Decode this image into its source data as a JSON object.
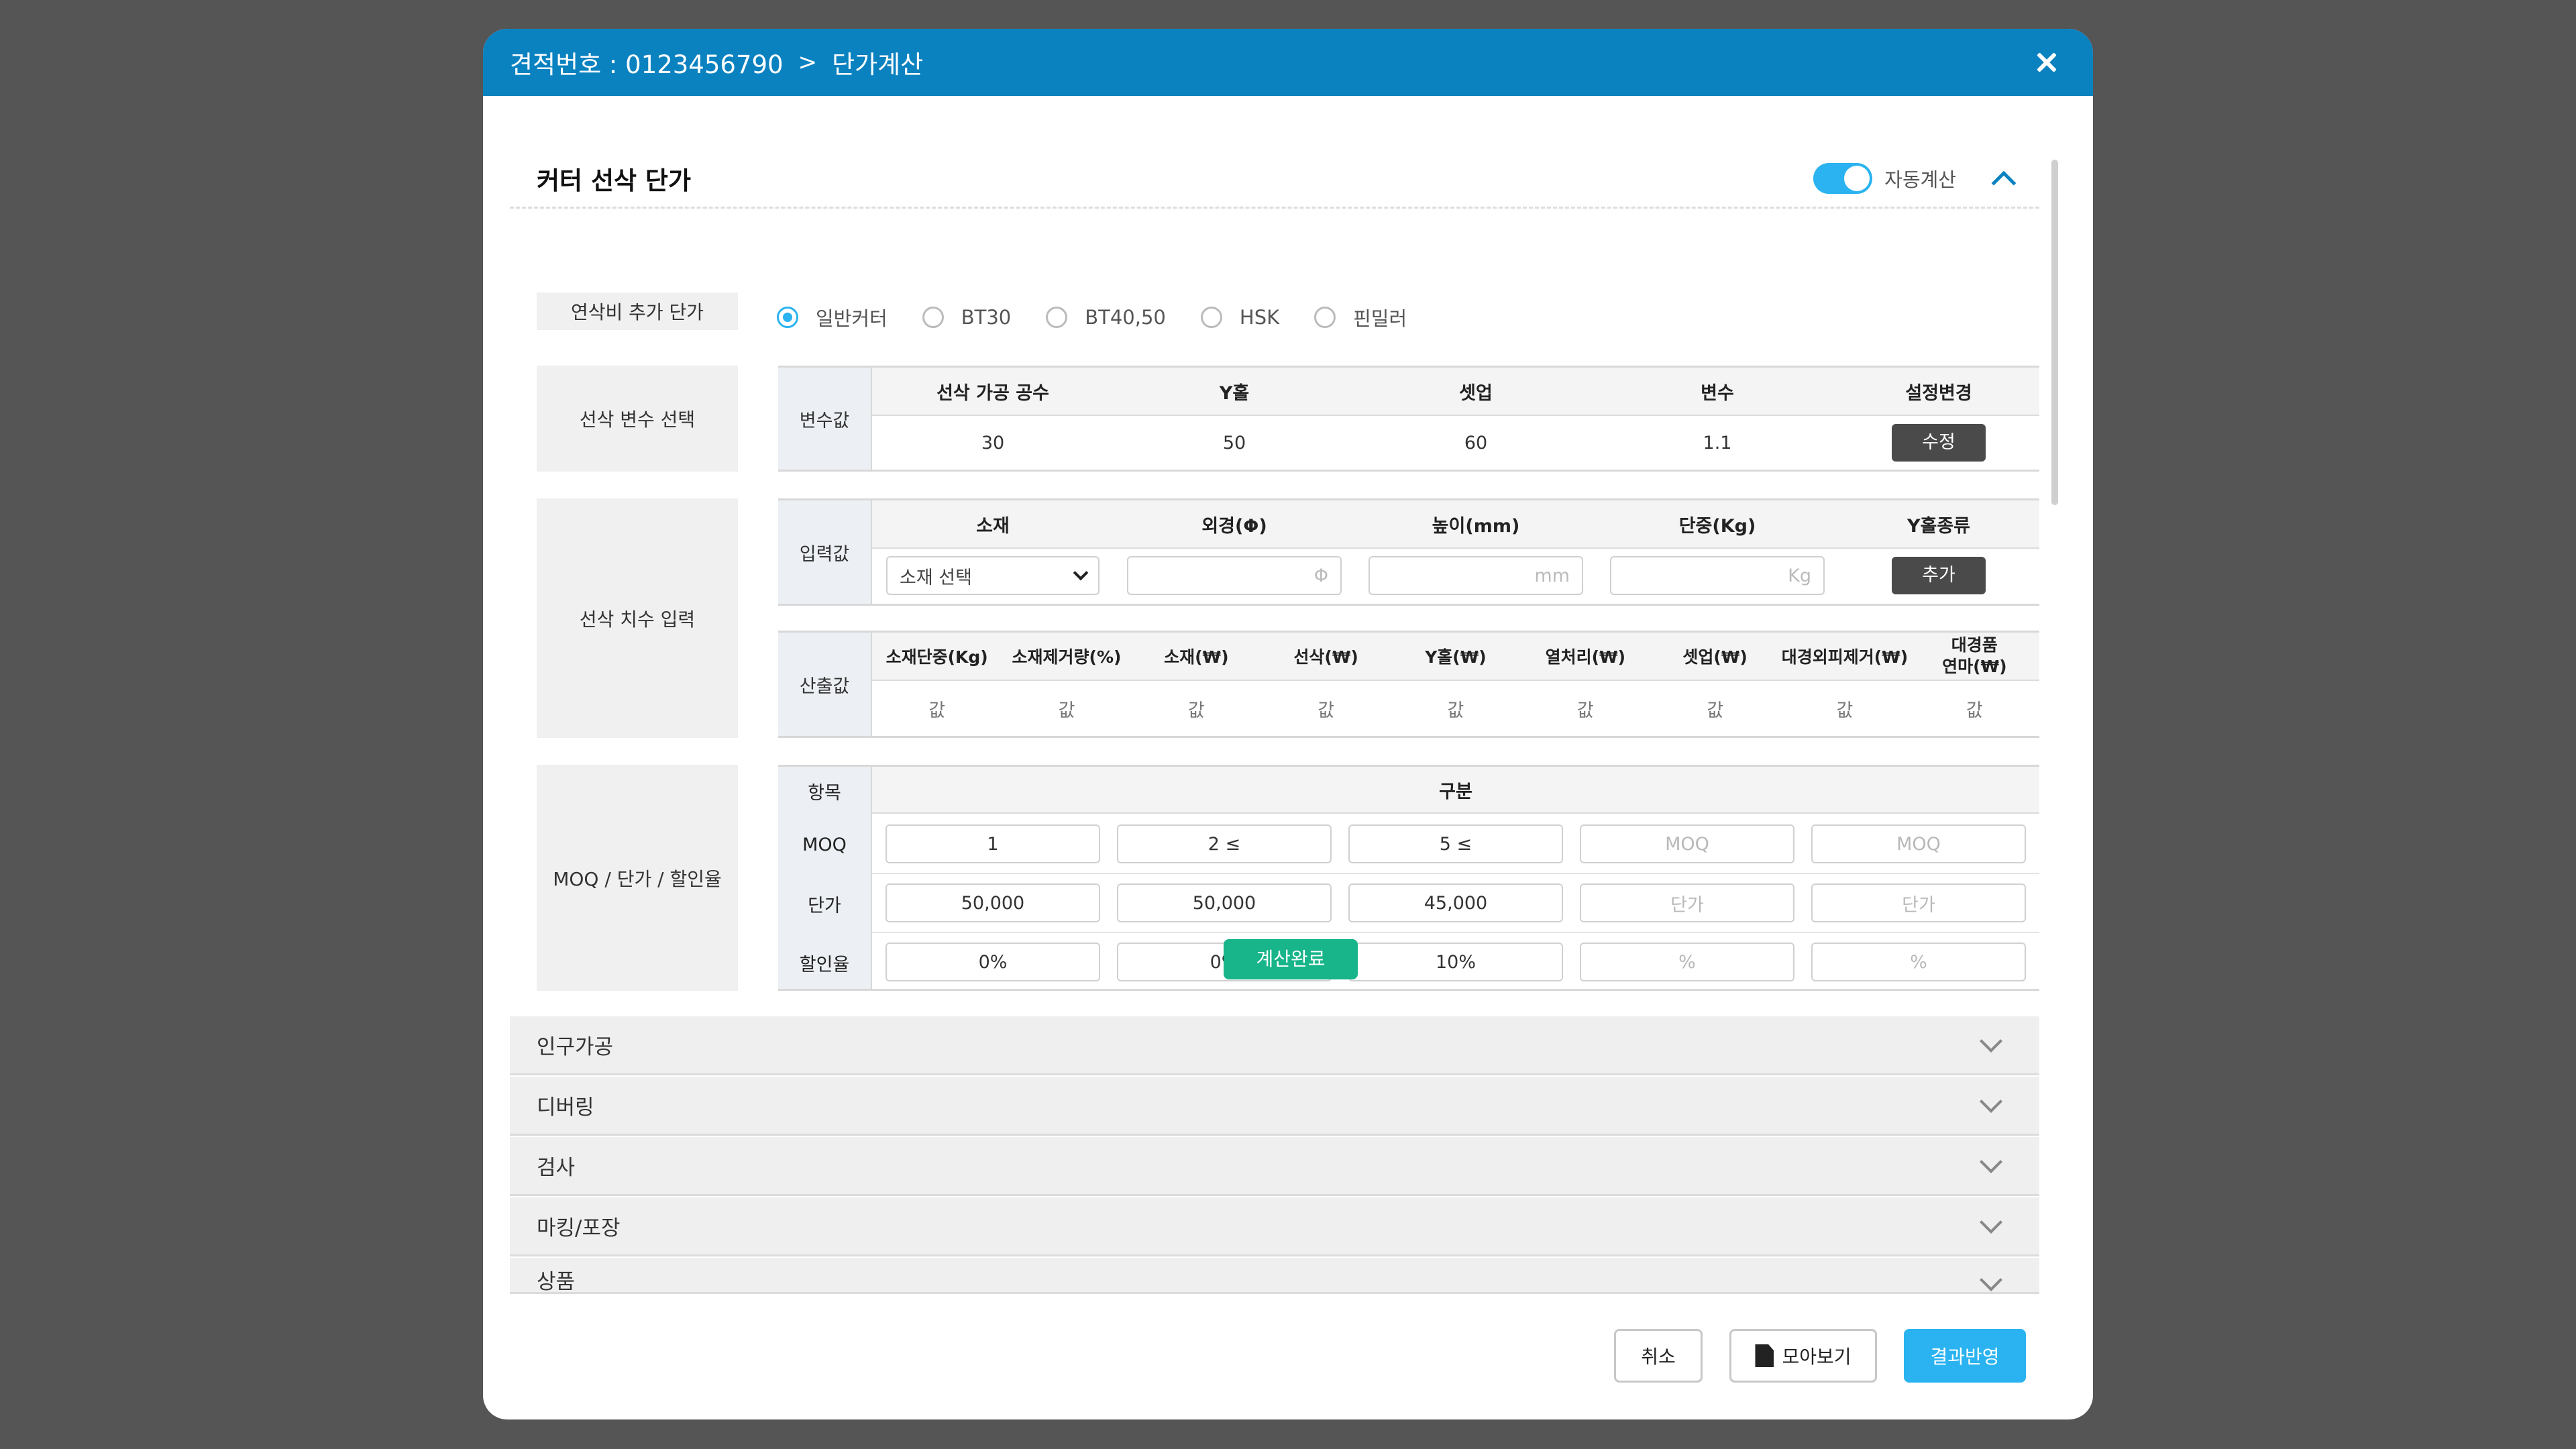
{
  "header": {
    "estimate_label": "견적번호 : 0123456790",
    "separator": ">",
    "page": "단가계산"
  },
  "section": {
    "title": "커터 선삭 단가",
    "toggle_label": "자동계산",
    "toggle_on": true
  },
  "extra_cost": {
    "label": "연삭비 추가 단가",
    "options": [
      "일반커터",
      "BT30",
      "BT40,50",
      "HSK",
      "핀밀러"
    ],
    "selected": "일반커터"
  },
  "variables": {
    "label": "선삭 변수 선택",
    "side": "변수값",
    "headers": [
      "선삭 가공 공수",
      "Y홀",
      "셋업",
      "변수",
      "설정변경"
    ],
    "values": [
      "30",
      "50",
      "60",
      "1.1"
    ],
    "edit_button": "수정"
  },
  "dimension": {
    "label": "선삭 치수 입력",
    "input_side": "입력값",
    "input_headers": [
      "소재",
      "외경(Φ)",
      "높이(mm)",
      "단중(Kg)",
      "Y홀종류"
    ],
    "material_select": "소재 선택",
    "diameter_unit": "Φ",
    "height_unit": "mm",
    "weight_unit": "Kg",
    "add_button": "추가",
    "output_side": "산출값",
    "output_headers": [
      "소재단중(Kg)",
      "소재제거량(%)",
      "소재(₩)",
      "선삭(₩)",
      "Y홀(₩)",
      "열처리(₩)",
      "셋업(₩)",
      "대경외피제거(₩)",
      "대경품\n연마(₩)"
    ],
    "output_values": [
      "값",
      "값",
      "값",
      "값",
      "값",
      "값",
      "값",
      "값",
      "값"
    ]
  },
  "moq": {
    "label": "MOQ / 단가 / 할인율",
    "item_header": "항목",
    "group_header": "구분",
    "rows": [
      {
        "name": "MOQ",
        "values": [
          "1",
          "2 ≤",
          "5 ≤",
          "MOQ",
          "MOQ"
        ],
        "placeholder": [
          false,
          false,
          false,
          true,
          true
        ]
      },
      {
        "name": "단가",
        "values": [
          "50,000",
          "50,000",
          "45,000",
          "단가",
          "단가"
        ],
        "placeholder": [
          false,
          false,
          false,
          true,
          true
        ]
      },
      {
        "name": "할인율",
        "values": [
          "0%",
          "0%",
          "10%",
          "%",
          "%"
        ],
        "placeholder": [
          false,
          false,
          false,
          true,
          true
        ]
      }
    ]
  },
  "calc_button": "계산완료",
  "accordions": [
    "인구가공",
    "디버링",
    "검사",
    "마킹/포장",
    "상품"
  ],
  "footer": {
    "cancel": "취소",
    "preview": "모아보기",
    "apply": "결과반영"
  },
  "colors": {
    "header": "#0b82c0",
    "accent": "#2ab3f0",
    "calc": "#18b48a",
    "backdrop": "#555555"
  }
}
